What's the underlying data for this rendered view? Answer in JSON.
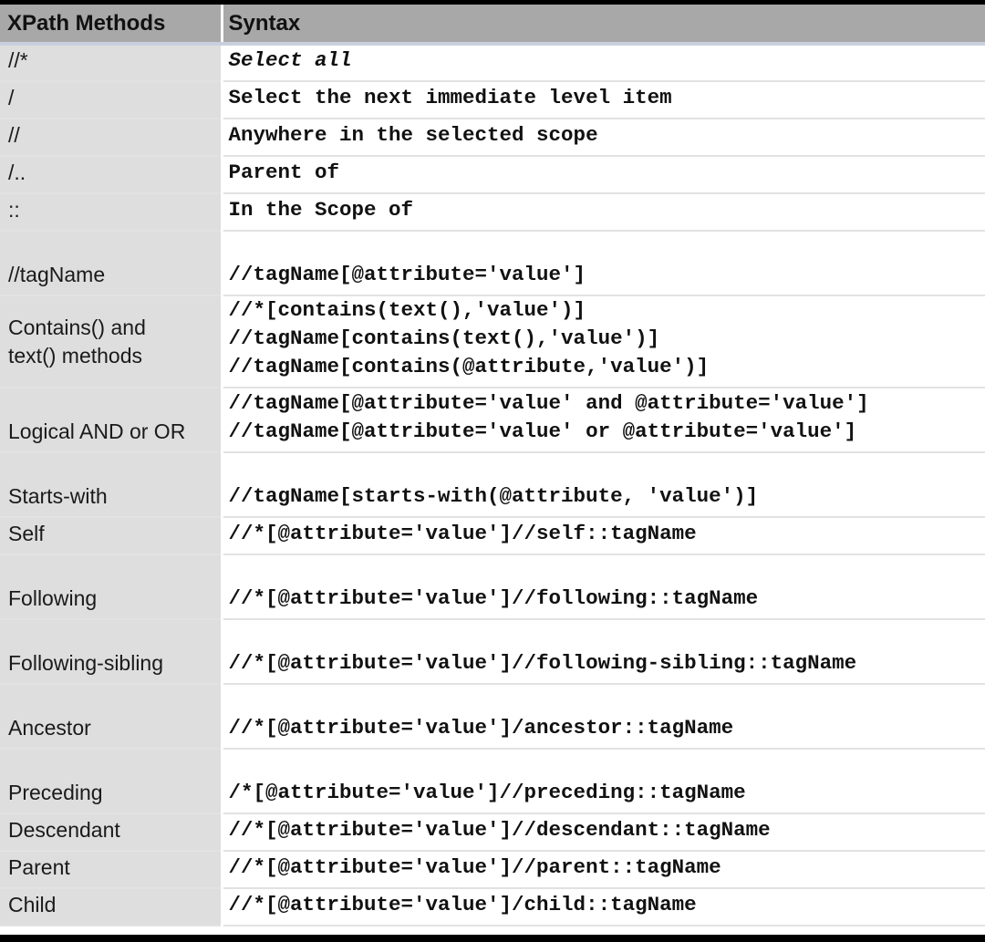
{
  "table": {
    "headers": {
      "method": "XPath Methods",
      "syntax": "Syntax"
    },
    "rows": [
      {
        "method": "//*",
        "syntax": [
          "Select all"
        ]
      },
      {
        "method": "/",
        "syntax": [
          "Select the next immediate level item"
        ]
      },
      {
        "method": "//",
        "syntax": [
          "Anywhere in the selected scope"
        ]
      },
      {
        "method": "/..",
        "syntax": [
          "Parent of"
        ]
      },
      {
        "method": "::",
        "syntax": [
          "In the Scope of"
        ]
      },
      {
        "method": "//tagName",
        "syntax": [
          "//tagName[@attribute='value']"
        ]
      },
      {
        "method": "Contains() and text() methods",
        "syntax": [
          "//*[contains(text(),'value')]",
          "//tagName[contains(text(),'value')]",
          "//tagName[contains(@attribute,'value')]"
        ]
      },
      {
        "method": "Logical AND or OR",
        "syntax": [
          "//tagName[@attribute='value' and @attribute='value']",
          "//tagName[@attribute='value' or @attribute='value']"
        ]
      },
      {
        "method": "Starts-with",
        "syntax": [
          "//tagName[starts-with(@attribute, 'value')]"
        ]
      },
      {
        "method": "Self",
        "syntax": [
          "//*[@attribute='value']//self::tagName"
        ]
      },
      {
        "method": "Following",
        "syntax": [
          "//*[@attribute='value']//following::tagName"
        ]
      },
      {
        "method": "Following-sibling",
        "syntax": [
          "//*[@attribute='value']//following-sibling::tagName"
        ]
      },
      {
        "method": "Ancestor",
        "syntax": [
          "//*[@attribute='value']/ancestor::tagName"
        ]
      },
      {
        "method": "Preceding",
        "syntax": [
          "/*[@attribute='value']//preceding::tagName"
        ]
      },
      {
        "method": "Descendant",
        "syntax": [
          "//*[@attribute='value']//descendant::tagName"
        ]
      },
      {
        "method": "Parent",
        "syntax": [
          "//*[@attribute='value']//parent::tagName"
        ]
      },
      {
        "method": "Child",
        "syntax": [
          "//*[@attribute='value']/child::tagName"
        ]
      }
    ]
  }
}
